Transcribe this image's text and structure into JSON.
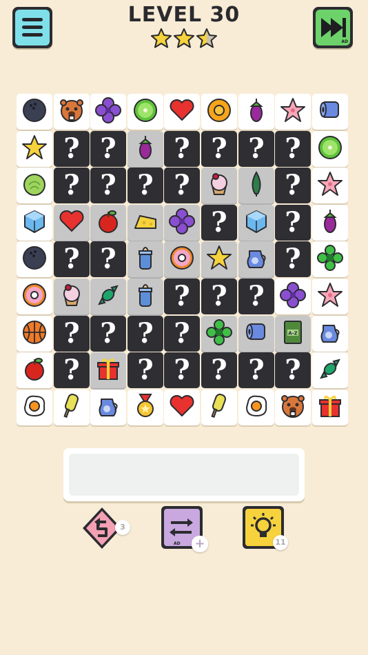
{
  "header": {
    "level_label": "LEVEL 30",
    "stars_filled": 2.5,
    "stars_total": 3,
    "skip_ad_label": "AD"
  },
  "board": {
    "rows": [
      [
        "bowling-ball",
        "beaver",
        "violet-flower",
        "kiwi",
        "heart",
        "orange-flower",
        "eggplant",
        "pink-flower",
        "toilet-paper"
      ],
      [
        "star",
        "?",
        "?",
        "eggplant",
        "?",
        "?",
        "?",
        "?",
        "kiwi"
      ],
      [
        "cabbage",
        "?",
        "?",
        "?",
        "?",
        "cupcake",
        "cypress-tree",
        "?",
        "pink-flower"
      ],
      [
        "ice-cube",
        "heart",
        "apple",
        "cheese",
        "violet-flower",
        "?",
        "ice-cube",
        "?",
        "eggplant"
      ],
      [
        "bowling-ball",
        "?",
        "?",
        "baby-bottle",
        "donut",
        "star",
        "jug",
        "?",
        "green-flower"
      ],
      [
        "donut",
        "cupcake",
        "candy",
        "baby-bottle",
        "?",
        "?",
        "?",
        "violet-flower",
        "pink-flower"
      ],
      [
        "basketball",
        "?",
        "?",
        "?",
        "?",
        "green-flower",
        "toilet-paper",
        "book",
        "jug"
      ],
      [
        "apple",
        "?",
        "gift",
        "?",
        "?",
        "?",
        "?",
        "?",
        "candy"
      ],
      [
        "fried-egg",
        "popsicle",
        "jug",
        "medal",
        "heart",
        "popsicle",
        "fried-egg",
        "beaver",
        "gift"
      ]
    ],
    "dimmed": [
      [
        1,
        3
      ],
      [
        2,
        5
      ],
      [
        2,
        6
      ],
      [
        3,
        1
      ],
      [
        3,
        2
      ],
      [
        3,
        3
      ],
      [
        3,
        4
      ],
      [
        3,
        6
      ],
      [
        4,
        3
      ],
      [
        4,
        4
      ],
      [
        4,
        5
      ],
      [
        4,
        6
      ],
      [
        5,
        1
      ],
      [
        5,
        2
      ],
      [
        5,
        3
      ],
      [
        6,
        5
      ],
      [
        6,
        6
      ],
      [
        6,
        7
      ],
      [
        7,
        2
      ]
    ],
    "book_label": "A-Z"
  },
  "tools": {
    "undo_count": "3",
    "shuffle_ad_label": "AD",
    "shuffle_plus": "+",
    "hint_count": "11"
  },
  "colors": {
    "background": "#f8ecd6",
    "menu_button": "#7fe0ea",
    "skip_button": "#6dd26a",
    "undo_card": "#f3a0b4",
    "shuffle_card": "#c8a8de",
    "hint_card": "#f6d23c",
    "hidden_tile": "#2e2e33",
    "star": "#f6d23c"
  }
}
